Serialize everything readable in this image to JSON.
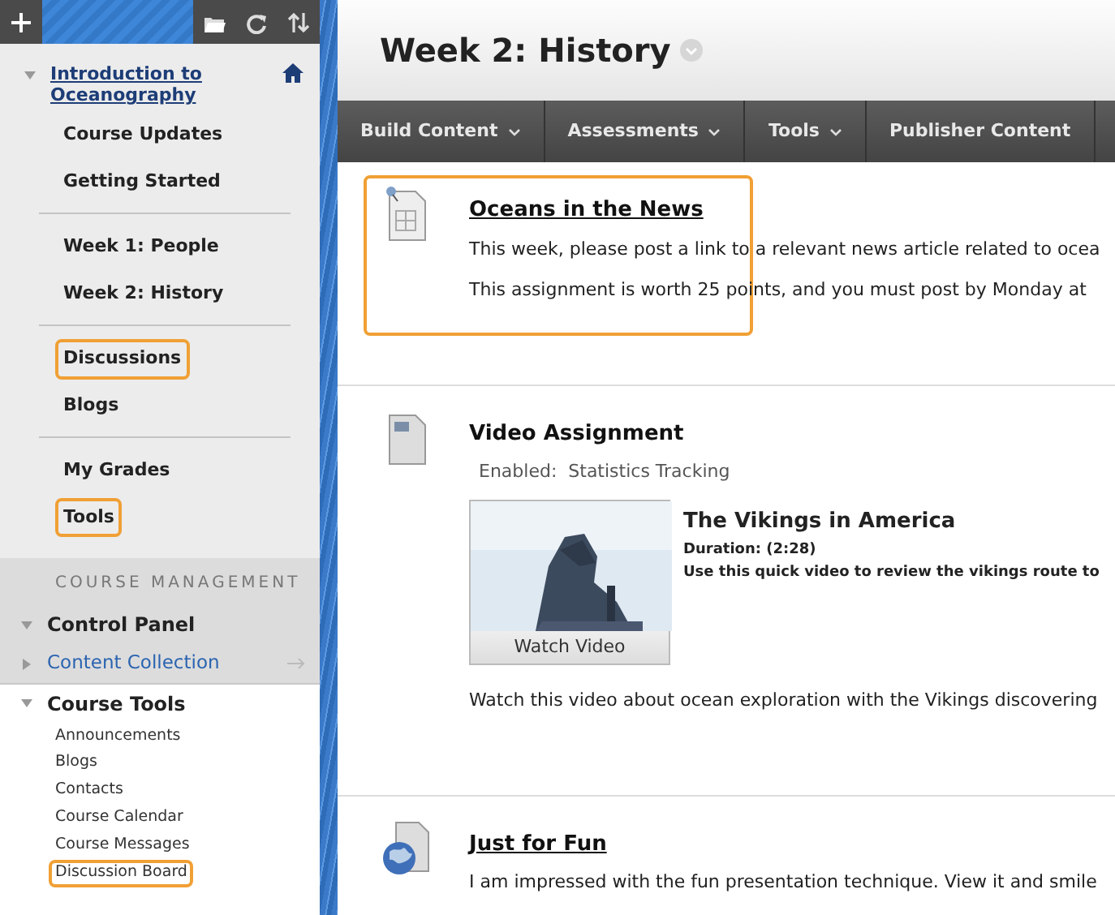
{
  "sidebar": {
    "toolbar": [
      {
        "kind": "add"
      },
      {
        "kind": "folder"
      },
      {
        "kind": "refresh"
      },
      {
        "kind": "sort"
      }
    ],
    "course": {
      "title": "Introduction to Oceanography",
      "expanded": true
    },
    "groups": [
      [
        {
          "label": "Course Updates",
          "highlighted": false
        },
        {
          "label": "Getting Started",
          "highlighted": false
        }
      ],
      [
        {
          "label": "Week 1: People",
          "highlighted": false
        },
        {
          "label": "Week 2: History",
          "highlighted": false
        }
      ],
      [
        {
          "label": "Discussions",
          "highlighted": true
        },
        {
          "label": "Blogs",
          "highlighted": false
        }
      ],
      [
        {
          "label": "My Grades",
          "highlighted": false
        },
        {
          "label": "Tools",
          "highlighted": true
        }
      ]
    ],
    "management": {
      "heading": "COURSE MANAGEMENT",
      "sections": [
        {
          "label": "Control Panel",
          "kind": "panel",
          "expanded": true
        },
        {
          "label": "Content Collection",
          "kind": "link",
          "expanded": false
        },
        {
          "label": "Course Tools",
          "kind": "panel",
          "expanded": true,
          "children": [
            {
              "label": "Announcements",
              "highlighted": false
            },
            {
              "label": "Blogs",
              "highlighted": false
            },
            {
              "label": "Contacts",
              "highlighted": false
            },
            {
              "label": "Course Calendar",
              "highlighted": false
            },
            {
              "label": "Course Messages",
              "highlighted": false
            },
            {
              "label": "Discussion Board",
              "highlighted": true
            }
          ]
        }
      ]
    }
  },
  "page": {
    "title": "Week 2: History",
    "menu": [
      {
        "label": "Build Content",
        "dropdown": true
      },
      {
        "label": "Assessments",
        "dropdown": true
      },
      {
        "label": "Tools",
        "dropdown": true
      },
      {
        "label": "Publisher Content",
        "dropdown": false
      }
    ],
    "items": [
      {
        "kind": "assignment",
        "title": "Oceans in the News",
        "link": true,
        "highlighted": true,
        "lines": [
          "This week, please post a link to a relevant news article related to ocea",
          "This assignment is worth 25 points, and you must post by Monday at"
        ]
      },
      {
        "kind": "video",
        "title": "Video Assignment",
        "link": false,
        "highlighted": false,
        "enabled_label": "Enabled:",
        "enabled_value": "Statistics Tracking",
        "video": {
          "kind": "picture",
          "button": "Watch Video",
          "title": "The Vikings in America",
          "duration": "Duration: (2:28)",
          "summary": "Use this quick video to review the vikings route to"
        },
        "lines": [
          "Watch this video about ocean exploration with the Vikings discovering"
        ]
      },
      {
        "kind": "link",
        "title": "Just for Fun",
        "link": true,
        "highlighted": false,
        "lines": [
          "I am impressed with the fun presentation technique. View it and smile"
        ]
      }
    ]
  }
}
